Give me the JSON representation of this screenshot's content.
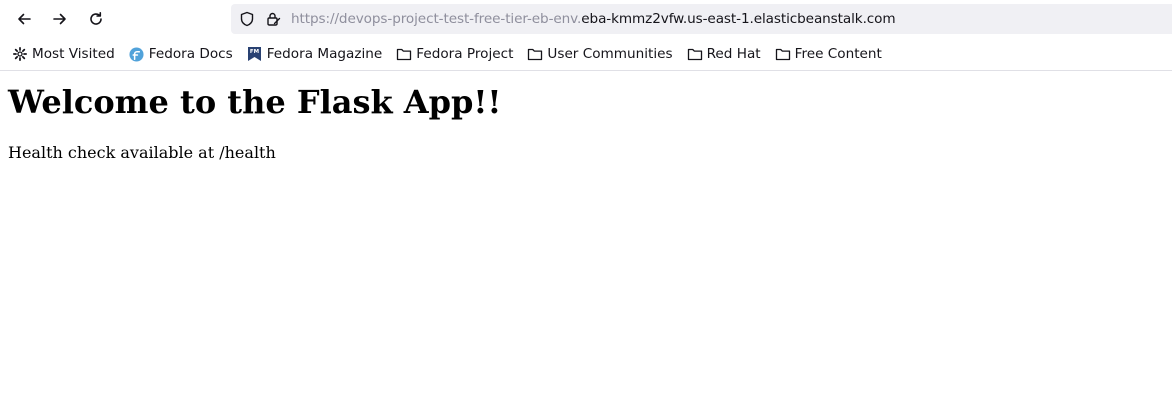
{
  "browser": {
    "nav": {
      "back_icon": "arrow-left-icon",
      "forward_icon": "arrow-right-icon",
      "reload_icon": "reload-icon"
    },
    "urlbar": {
      "security_icon": "shield-icon",
      "lock_icon": "lock-icon",
      "url_dim": "https://devops-project-test-free-tier-eb-env.",
      "url_host": "eba-kmmz2vfw.us-east-1.elasticbeanstalk.com"
    },
    "bookmarks": [
      {
        "label": "Most Visited",
        "icon": "gear-icon"
      },
      {
        "label": "Fedora Docs",
        "icon": "fedora-logo-icon"
      },
      {
        "label": "Fedora Magazine",
        "icon": "fedora-magazine-icon"
      },
      {
        "label": "Fedora Project",
        "icon": "folder-icon"
      },
      {
        "label": "User Communities",
        "icon": "folder-icon"
      },
      {
        "label": "Red Hat",
        "icon": "folder-icon"
      },
      {
        "label": "Free Content",
        "icon": "folder-icon"
      }
    ],
    "colors": {
      "urlbar_bg": "#f0f0f4",
      "url_dim": "#8f8f9d",
      "text": "#15141a",
      "fedora_blue": "#51a2da",
      "magazine_blue": "#294172"
    }
  },
  "page": {
    "heading": "Welcome to the Flask App!!",
    "body_text": "Health check available at /health"
  }
}
